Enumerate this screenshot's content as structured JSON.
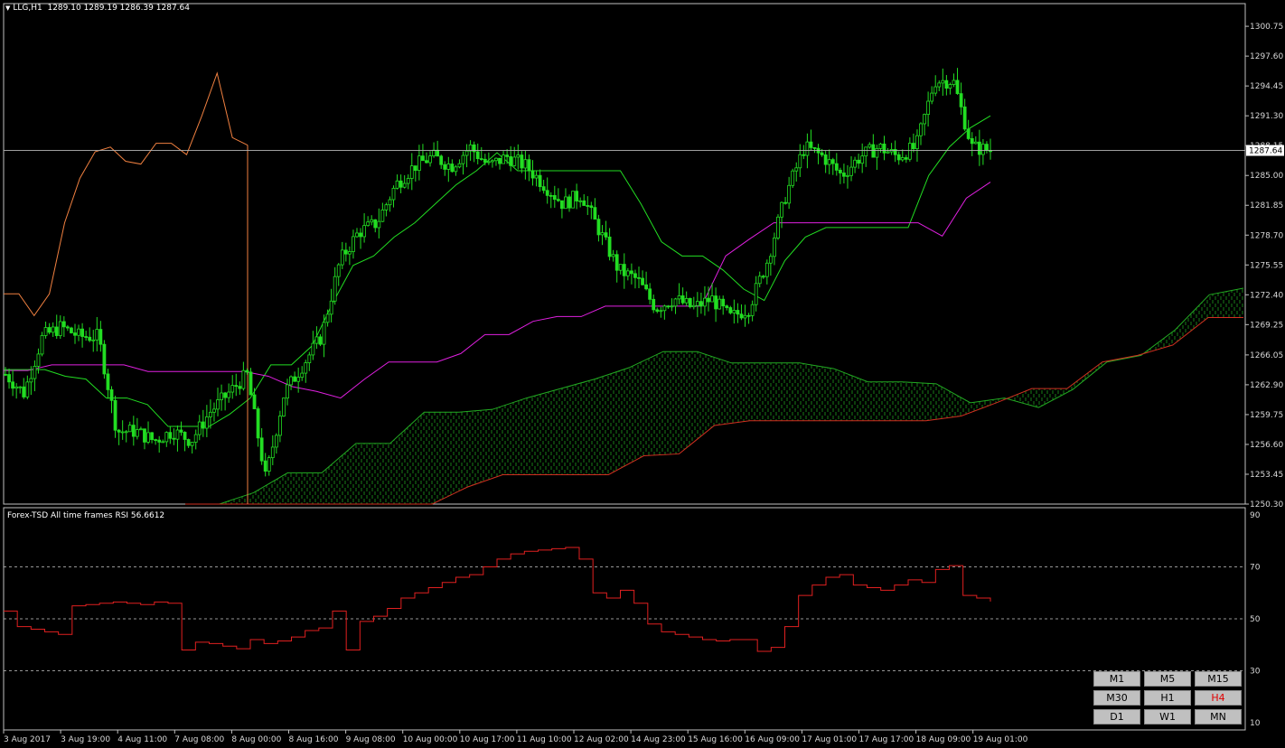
{
  "info": {
    "symbol": "LLG,H1",
    "open": "1289.10",
    "high": "1289.19",
    "low": "1286.39",
    "close": "1287.64"
  },
  "rsi": {
    "title": "Forex-TSD All time frames RSI 56.6612",
    "levels": [
      "90",
      "70",
      "50",
      "30",
      "10"
    ]
  },
  "timeframes": [
    {
      "label": "M1",
      "active": false
    },
    {
      "label": "M5",
      "active": false
    },
    {
      "label": "M15",
      "active": false
    },
    {
      "label": "M30",
      "active": false
    },
    {
      "label": "H1",
      "active": false
    },
    {
      "label": "H4",
      "active": true
    },
    {
      "label": "D1",
      "active": false
    },
    {
      "label": "W1",
      "active": false
    },
    {
      "label": "MN",
      "active": false
    }
  ],
  "chart_data": {
    "type": "candlestick",
    "ylim": [
      1250.3,
      1302.0
    ],
    "price_ticks": [
      1300.75,
      1297.6,
      1294.45,
      1291.3,
      1288.15,
      1285.0,
      1281.85,
      1278.7,
      1275.55,
      1272.4,
      1269.25,
      1266.05,
      1262.9,
      1259.75,
      1256.6,
      1253.45,
      1250.3
    ],
    "current_price": 1287.64,
    "current_price_label": "1287.64",
    "x_labels": [
      "3 Aug 2017",
      "3 Aug 19:00",
      "4 Aug 11:00",
      "7 Aug 08:00",
      "8 Aug 00:00",
      "8 Aug 16:00",
      "9 Aug 08:00",
      "10 Aug 00:00",
      "10 Aug 17:00",
      "11 Aug 10:00",
      "12 Aug 02:00",
      "14 Aug 23:00",
      "15 Aug 16:00",
      "16 Aug 09:00",
      "17 Aug 01:00",
      "17 Aug 17:00",
      "18 Aug 09:00",
      "19 Aug 01:00"
    ],
    "close_path": [
      1264,
      1262,
      1268,
      1269,
      1268,
      1268,
      1258,
      1258,
      1257,
      1258,
      1257,
      1260,
      1262,
      1264,
      1253,
      1262,
      1265,
      1268,
      1276,
      1279,
      1280,
      1284,
      1286,
      1287,
      1286,
      1288,
      1286,
      1287,
      1286,
      1284,
      1282,
      1283,
      1279,
      1275,
      1274,
      1271,
      1272,
      1271,
      1272,
      1270,
      1271,
      1276,
      1283,
      1288,
      1287,
      1285,
      1287,
      1288,
      1287,
      1288,
      1295,
      1295,
      1288,
      1287.64
    ],
    "tenkan": [
      1264.5,
      1264.5,
      1264.5,
      1263.8,
      1263.5,
      1261.5,
      1261.5,
      1260.8,
      1258.5,
      1258.5,
      1258.5,
      1259.8,
      1261.5,
      1265,
      1265,
      1267,
      1271.5,
      1275.5,
      1276.5,
      1278.5,
      1280,
      1282,
      1284,
      1285.5,
      1287.4,
      1285.5,
      1285.5,
      1285.5,
      1285.5,
      1285.5,
      1285.5,
      1282,
      1278,
      1276.5,
      1276.5,
      1275,
      1273,
      1271.8,
      1276,
      1278.5,
      1279.5,
      1279.5,
      1279.5,
      1279.5,
      1279.5,
      1285,
      1288,
      1290,
      1291.3
    ],
    "kijun": [
      1264.4,
      1264.4,
      1265,
      1265,
      1265,
      1265,
      1264.3,
      1264.3,
      1264.3,
      1264.3,
      1264.3,
      1263.8,
      1262.7,
      1262.2,
      1261.5,
      1263.5,
      1265.3,
      1265.3,
      1265.3,
      1266.2,
      1268.2,
      1268.2,
      1269.6,
      1270.1,
      1270.1,
      1271.2,
      1271.2,
      1271.2,
      1271.2,
      1271.2,
      1276.5,
      1278.3,
      1280,
      1280,
      1280,
      1280,
      1280,
      1280,
      1280,
      1278.6,
      1282.6,
      1284.3
    ],
    "chikou": [
      1272.5,
      1272.5,
      1270.2,
      1272.5,
      1280,
      1284.7,
      1287.5,
      1288,
      1286.5,
      1286.2,
      1288.4,
      1288.4,
      1287.2,
      1291.3,
      1295.8,
      1289,
      1288.2
    ],
    "span_a": [
      1250.3,
      1250.3,
      1251.5,
      1253.6,
      1253.6,
      1256.7,
      1256.7,
      1260,
      1260,
      1260.3,
      1261.5,
      1262.5,
      1263.5,
      1264.7,
      1266.4,
      1266.4,
      1265.2,
      1265.2,
      1265.2,
      1264.6,
      1263.2,
      1263.2,
      1263,
      1261,
      1261.5,
      1260.5,
      1262.4,
      1265.3,
      1266,
      1268.7,
      1272.4,
      1273.1
    ],
    "span_b": [
      1250.3,
      1250.3,
      1250.3,
      1250.3,
      1250.3,
      1250.3,
      1250.3,
      1250.3,
      1252.1,
      1253.4,
      1253.4,
      1253.4,
      1253.4,
      1255.4,
      1255.6,
      1258.6,
      1259.1,
      1259.1,
      1259.1,
      1259.1,
      1259.1,
      1259.1,
      1259.6,
      1261,
      1262.5,
      1262.5,
      1265.3,
      1266,
      1267.1,
      1270,
      1270
    ],
    "rsi_values": [
      53,
      47,
      46,
      45,
      44,
      55,
      55.5,
      56,
      56.5,
      56,
      55.5,
      56.5,
      56,
      38,
      41,
      40.5,
      39.5,
      38.5,
      42,
      40.5,
      41.5,
      43,
      45.5,
      46.5,
      53,
      38,
      49,
      51,
      54,
      58,
      60,
      62,
      64,
      66,
      67,
      70,
      73,
      75,
      76,
      76.5,
      77,
      77.5,
      73,
      60,
      58,
      61,
      56,
      48,
      45,
      44,
      43,
      42,
      41.5,
      42,
      42,
      37.5,
      39,
      47,
      59,
      63,
      66,
      67,
      63,
      62,
      61,
      63,
      65,
      64,
      69,
      70.5,
      59,
      58,
      56.66
    ]
  }
}
